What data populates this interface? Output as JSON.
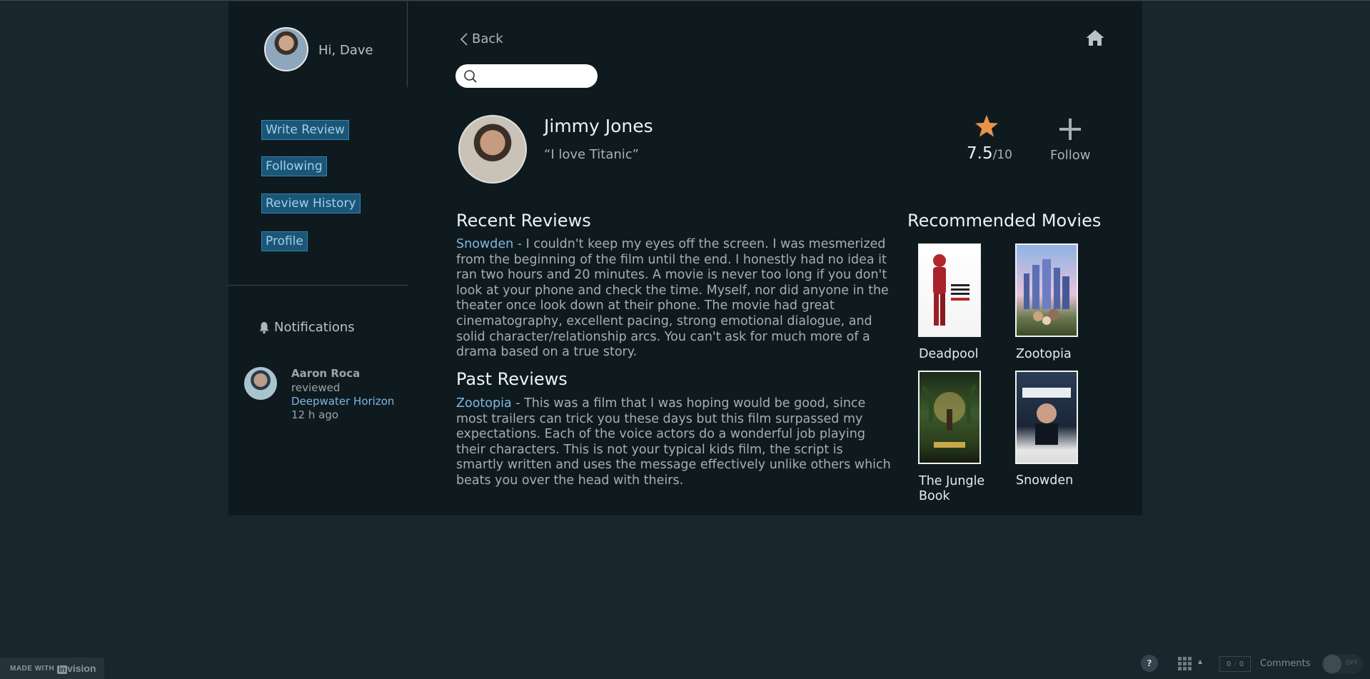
{
  "user": {
    "greeting": "Hi, Dave"
  },
  "sidebar": {
    "nav": [
      {
        "label": "Write Review"
      },
      {
        "label": "Following"
      },
      {
        "label": "Review History"
      },
      {
        "label": "Profile"
      }
    ],
    "notifications_title": "Notifications",
    "notification": {
      "name": "Aaron Roca",
      "action": "reviewed",
      "movie": "Deepwater Horizon",
      "time": "12 h ago"
    }
  },
  "header": {
    "back_label": "Back",
    "search_placeholder": ""
  },
  "profile": {
    "name": "Jimmy Jones",
    "quote": "“I love Titanic”",
    "rating_value": "7.5",
    "rating_max": "/10",
    "follow_label": "Follow"
  },
  "recent": {
    "title": "Recent Reviews",
    "movie": "Snowden",
    "text": " - I couldn't keep my eyes off the screen. I was mesmerized from the beginning of the film until the end. I honestly had no idea it ran two hours and 20 minutes. A movie is never too long if you don't look at your phone and check the time. Myself, nor did anyone in the theater once look down at their phone. The movie had great cinematography, excellent pacing, strong emotional dialogue, and solid character/relationship arcs. You can't ask for much more of a drama based on a true story."
  },
  "past": {
    "title": "Past Reviews",
    "movie": "Zootopia",
    "text": " - This was a film that I was hoping would be good, since most trailers can trick you these days but this film surpassed my expectations. Each of the voice actors do a wonderful job playing their characters. This is not your typical kids film, the script is smartly written and uses the message effectively unlike others which beats you over the head with theirs."
  },
  "recommended": {
    "title": "Recommended Movies",
    "movies": [
      {
        "title": "Deadpool"
      },
      {
        "title": "Zootopia"
      },
      {
        "title": "The Jungle Book"
      },
      {
        "title": "Snowden"
      }
    ]
  },
  "footer": {
    "made_with": "MADE WITH",
    "brand_box": "in",
    "brand_rest": "vision",
    "help": "?",
    "counter_a": "0",
    "counter_b": "0",
    "comments": "Comments",
    "toggle": "OFF"
  },
  "colors": {
    "background": "#1a262d",
    "panel": "#0f1a1f",
    "nav_button": "#1c5576",
    "link": "#7fb7df",
    "star": "#e8924a"
  },
  "icons": [
    "back-chevron-icon",
    "home-icon",
    "search-icon",
    "star-icon",
    "plus-icon",
    "bell-icon",
    "grid-icon"
  ]
}
